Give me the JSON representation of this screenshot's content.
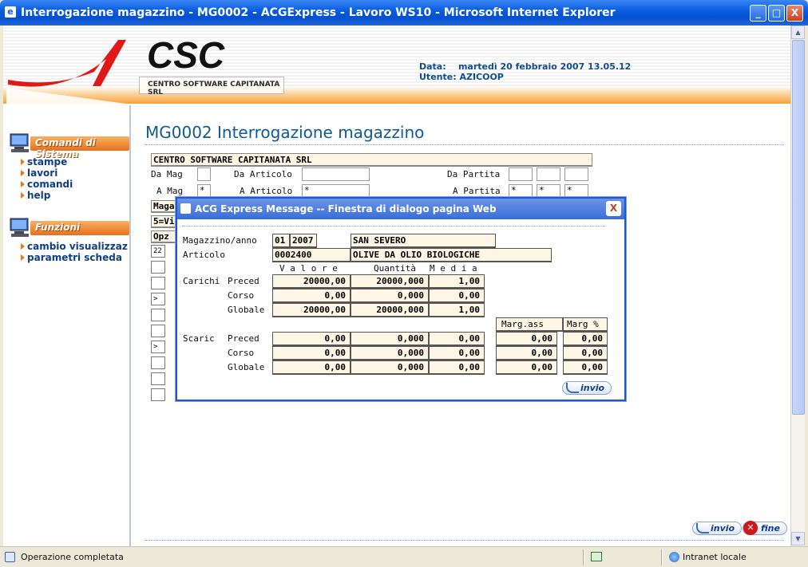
{
  "window": {
    "title": "Interrogazione magazzino - MG0002 - ACGExpress - Lavoro WS10 - Microsoft Internet Explorer",
    "minimize": "_",
    "maximize": "□",
    "close": "X"
  },
  "header": {
    "logo_text": "CSC",
    "logo_subtitle": "CENTRO SOFTWARE CAPITANATA SRL",
    "date_label": "Data:",
    "date_value": "martedì 20 febbraio 2007 13.05.12",
    "user_label": "Utente:",
    "user_value": "AZICOOP"
  },
  "sidebar": {
    "system_title": "Comandi di Sistema",
    "system_items": [
      "stampe",
      "lavori",
      "comandi",
      "help"
    ],
    "functions_title": "Funzioni",
    "function_items": [
      "cambio visualizzaz",
      "parametri scheda"
    ]
  },
  "main": {
    "page_title": "MG0002 Interrogazione magazzino",
    "company": "CENTRO SOFTWARE CAPITANATA SRL",
    "da_mag_label": "Da Mag",
    "a_mag_label": "A Mag",
    "a_mag_value": "*",
    "da_articolo_label": "Da Articolo",
    "a_articolo_label": "A Articolo",
    "a_articolo_value": "*",
    "da_partita_label": "Da Partita",
    "a_partita_label": "A Partita",
    "a_partita_values": [
      "*",
      "*",
      "*"
    ],
    "row_maga": "Maga",
    "row_vis": "5=Vi",
    "opz_header": "Opz",
    "opz_values": [
      "22",
      "",
      "",
      ">",
      "",
      "",
      ">",
      "",
      "",
      ""
    ],
    "invio_label": "invio",
    "fine_label": "fine"
  },
  "dialog": {
    "title": "ACG Express Message -- Finestra di dialogo pagina Web",
    "close": "X",
    "magazzino_label": "Magazzino/anno",
    "mag_code": "01",
    "mag_year": "2007",
    "mag_name": "SAN SEVERO",
    "articolo_label": "Articolo",
    "articolo_code": "0002400",
    "articolo_desc": "OLIVE DA OLIO BIOLOGICHE",
    "col_valore": "V a l o r e",
    "col_quantita": "Quantità",
    "col_media": "M e d i a",
    "col_marg_ass": "Marg.ass",
    "col_marg_pct": "Marg %",
    "carichi_label": "Carichi",
    "scarici_label": "Scaric",
    "row_labels": [
      "Preced",
      "Corso",
      "Globale"
    ],
    "carichi": [
      {
        "valore": "20000,00",
        "quantita": "20000,000",
        "media": "1,00"
      },
      {
        "valore": "0,00",
        "quantita": "0,000",
        "media": "0,00"
      },
      {
        "valore": "20000,00",
        "quantita": "20000,000",
        "media": "1,00"
      }
    ],
    "scarichi": [
      {
        "valore": "0,00",
        "quantita": "0,000",
        "media": "0,00",
        "marg_ass": "0,00",
        "marg_pct": "0,00"
      },
      {
        "valore": "0,00",
        "quantita": "0,000",
        "media": "0,00",
        "marg_ass": "0,00",
        "marg_pct": "0,00"
      },
      {
        "valore": "0,00",
        "quantita": "0,000",
        "media": "0,00",
        "marg_ass": "0,00",
        "marg_pct": "0,00"
      }
    ],
    "invio_label": "invio"
  },
  "statusbar": {
    "text": "Operazione completata",
    "zone": "Intranet locale"
  }
}
